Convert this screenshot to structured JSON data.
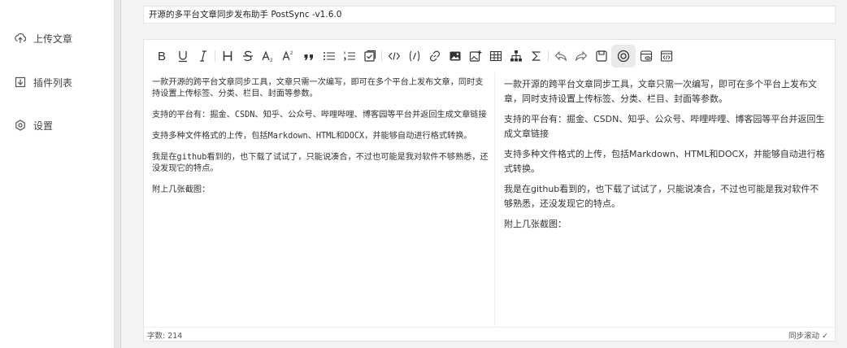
{
  "sidebar": {
    "items": [
      {
        "label": "上传文章",
        "icon": "upload-icon"
      },
      {
        "label": "插件列表",
        "icon": "plugin-icon"
      },
      {
        "label": "设置",
        "icon": "settings-icon"
      }
    ]
  },
  "header": {
    "title": "开源的多平台文章同步发布助手 PostSync -v1.6.0"
  },
  "toolbar": {
    "buttons": [
      "B",
      "U",
      "I",
      "H",
      "S",
      "A",
      "A",
      "“",
      "☰",
      "☰",
      "⊞",
      "</>",
      "{/}",
      "link",
      "image",
      "image-add",
      "table",
      "tree",
      "Σ",
      "undo",
      "redo",
      "save",
      "preview",
      "fullscreen",
      "html"
    ]
  },
  "editor": {
    "source": [
      "一款开源的跨平台文章同步工具，文章只需一次编写，即可在多个平台上发布文章，同时支持设置上传标签、分类、栏目、封面等参数。",
      "支持的平台有：掘金、CSDN、知乎、公众号、哔哩哔哩、博客园等平台并返回生成文章链接",
      "支持多种文件格式的上传，包括Markdown、HTML和DOCX，并能够自动进行格式转换。",
      "我是在github看到的，也下载了试试了，只能说凑合，不过也可能是我对软件不够熟悉，还没发现它的特点。",
      "附上几张截图："
    ],
    "preview": [
      "一款开源的跨平台文章同步工具，文章只需一次编写，即可在多个平台上发布文章，同时支持设置上传标签、分类、栏目、封面等参数。",
      "支持的平台有：掘金、CSDN、知乎、公众号、哔哩哔哩、博客园等平台并返回生成文章链接",
      "支持多种文件格式的上传，包括Markdown、HTML和DOCX，并能够自动进行格式转换。",
      "我是在github看到的，也下载了试试了，只能说凑合，不过也可能是我对软件不够熟悉，还没发现它的特点。",
      "附上几张截图："
    ]
  },
  "status": {
    "word_count": "字数: 214",
    "sync_scroll": "同步滚动 ✓"
  }
}
